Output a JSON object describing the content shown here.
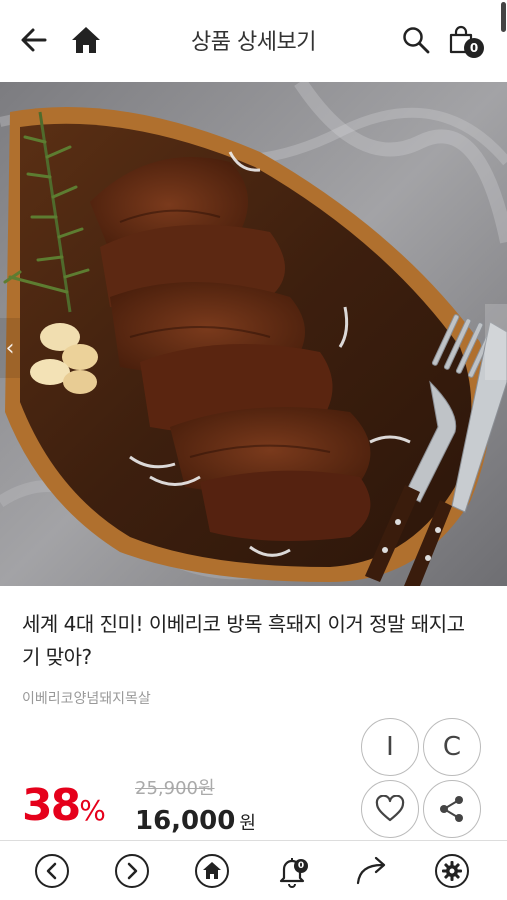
{
  "header": {
    "title": "상품 상세보기",
    "back_icon": "arrow-left-icon",
    "home_icon": "home-icon",
    "search_icon": "search-icon",
    "cart_icon": "shopping-bag-icon",
    "cart_count": "0"
  },
  "hero": {
    "prev_arrow": "‹"
  },
  "product": {
    "title": "세계 4대 진미! 이베리코 방목 흑돼지 이거 정말 돼지고기 맞아?",
    "subtitle": "이베리코양념돼지목살",
    "discount_number": "38",
    "discount_unit": "%",
    "original_price": "25,900원",
    "sale_price": "16,000",
    "sale_unit": "원",
    "discount_color": "#e5001b"
  },
  "actions": {
    "btn_i_label": "I",
    "btn_c_label": "C",
    "like_icon": "heart-icon",
    "share_icon": "share-icon"
  },
  "bottom_nav": {
    "items": [
      "chevron-left-icon",
      "chevron-right-icon",
      "home-icon",
      "bell-icon",
      "forward-arrow-icon",
      "settings-icon"
    ],
    "bell_count": "0"
  }
}
